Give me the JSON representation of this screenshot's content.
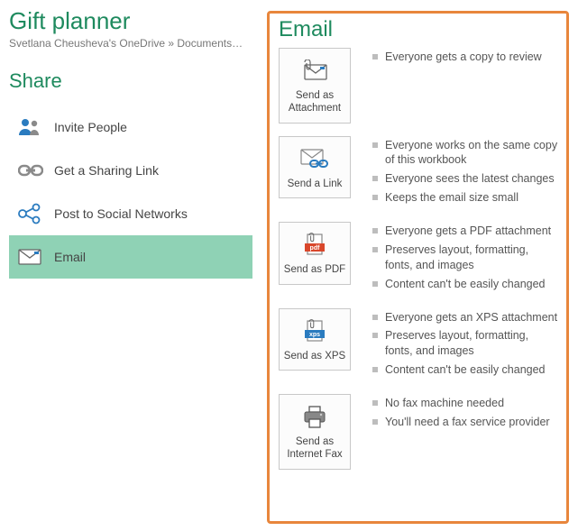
{
  "doc_title": "Gift planner",
  "breadcrumb": "Svetlana Cheusheva's OneDrive » Documents » G...",
  "share_title": "Share",
  "share_items": [
    {
      "label": "Invite People"
    },
    {
      "label": "Get a Sharing Link"
    },
    {
      "label": "Post to Social Networks"
    },
    {
      "label": "Email"
    }
  ],
  "panel_title": "Email",
  "options": [
    {
      "label": "Send as Attachment",
      "bullets": [
        "Everyone gets a copy to review"
      ]
    },
    {
      "label": "Send a Link",
      "bullets": [
        "Everyone works on the same copy of this workbook",
        "Everyone sees the latest changes",
        "Keeps the email size small"
      ]
    },
    {
      "label": "Send as PDF",
      "bullets": [
        "Everyone gets a PDF attachment",
        "Preserves layout, formatting, fonts, and images",
        "Content can't be easily changed"
      ]
    },
    {
      "label": "Send as XPS",
      "bullets": [
        "Everyone gets an XPS attachment",
        "Preserves layout, formatting, fonts, and images",
        "Content can't be easily changed"
      ]
    },
    {
      "label": "Send as Internet Fax",
      "bullets": [
        "No fax machine needed",
        "You'll need a fax service provider"
      ]
    }
  ]
}
